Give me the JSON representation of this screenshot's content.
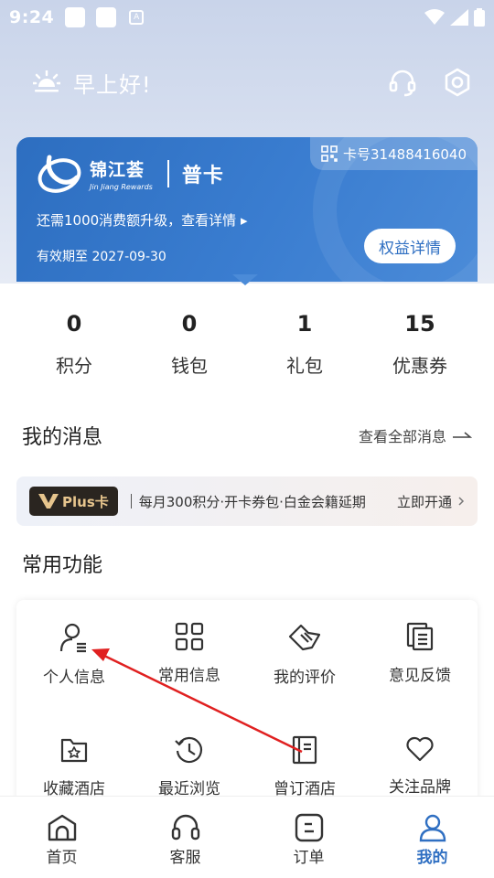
{
  "status_bar": {
    "time": "9:24"
  },
  "header": {
    "greeting": "早上好!"
  },
  "card": {
    "brand_cn": "锦江荟",
    "brand_en": "Jin Jiang Rewards",
    "level": "普卡",
    "card_number": "卡号31488416040",
    "upgrade_text": "还需1000消费额升级，查看详情 ▸",
    "expiry": "有效期至 2027-09-30",
    "benefits_button": "权益详情"
  },
  "stats": [
    {
      "value": "0",
      "label": "积分"
    },
    {
      "value": "0",
      "label": "钱包"
    },
    {
      "value": "1",
      "label": "礼包"
    },
    {
      "value": "15",
      "label": "优惠券"
    }
  ],
  "messages": {
    "title": "我的消息",
    "view_all": "查看全部消息"
  },
  "plus_banner": {
    "badge": "Plus卡",
    "text": "每月300积分·开卡券包·白金会籍延期",
    "action": "立即开通"
  },
  "functions": {
    "title": "常用功能",
    "items": [
      {
        "label": "个人信息",
        "icon": "person-icon"
      },
      {
        "label": "常用信息",
        "icon": "grid-icon"
      },
      {
        "label": "我的评价",
        "icon": "review-icon"
      },
      {
        "label": "意见反馈",
        "icon": "feedback-icon"
      },
      {
        "label": "收藏酒店",
        "icon": "favorite-folder-icon"
      },
      {
        "label": "最近浏览",
        "icon": "history-icon"
      },
      {
        "label": "曾订酒店",
        "icon": "booked-icon"
      },
      {
        "label": "关注品牌",
        "icon": "heart-icon"
      }
    ]
  },
  "bottom_nav": [
    {
      "label": "首页",
      "icon": "home-icon"
    },
    {
      "label": "客服",
      "icon": "headset-icon"
    },
    {
      "label": "订单",
      "icon": "order-icon"
    },
    {
      "label": "我的",
      "icon": "profile-icon"
    }
  ],
  "colors": {
    "accent": "#2f6fc2",
    "card": "#3a7dd0",
    "annotation": "#e02020"
  }
}
